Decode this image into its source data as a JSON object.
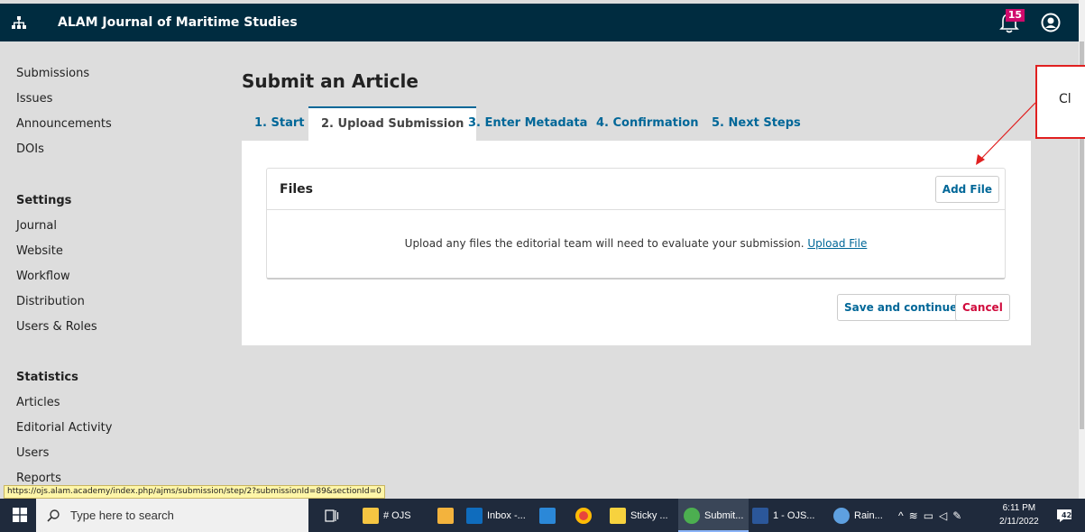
{
  "header": {
    "journal_title": "ALAM Journal of Maritime Studies",
    "notification_count": "15"
  },
  "sidebar": {
    "items": [
      "Submissions",
      "Issues",
      "Announcements",
      "DOIs"
    ],
    "settings_heading": "Settings",
    "settings_items": [
      "Journal",
      "Website",
      "Workflow",
      "Distribution",
      "Users & Roles"
    ],
    "statistics_heading": "Statistics",
    "statistics_items": [
      "Articles",
      "Editorial Activity",
      "Users",
      "Reports"
    ]
  },
  "main": {
    "page_title": "Submit an Article",
    "tabs": [
      "1. Start",
      "2. Upload Submission",
      "3. Enter Metadata",
      "4. Confirmation",
      "5. Next Steps"
    ],
    "active_tab": "2. Upload Submission",
    "files_heading": "Files",
    "add_file_label": "Add File",
    "upload_message": "Upload any files the editorial team will need to evaluate your submission.",
    "upload_link": "Upload File",
    "save_label": "Save and continue",
    "cancel_label": "Cancel"
  },
  "callout": {
    "text": "Cl"
  },
  "status_url": "https://ojs.alam.academy/index.php/ajms/submission/step/2?submissionId=89&sectionId=0",
  "taskbar": {
    "search_placeholder": "Type here to search",
    "items": [
      "# OJS",
      "Inbox -...",
      "Sticky ...",
      "Submit...",
      "1 - OJS...",
      "Rain..."
    ],
    "time": "6:11 PM",
    "date": "2/11/2022",
    "notif_count": "42"
  },
  "colors": {
    "header_bg": "#002c40",
    "link_blue": "#006798",
    "cancel_red": "#d00a3c",
    "badge": "#d00a6c",
    "callout_red": "#e02020"
  }
}
